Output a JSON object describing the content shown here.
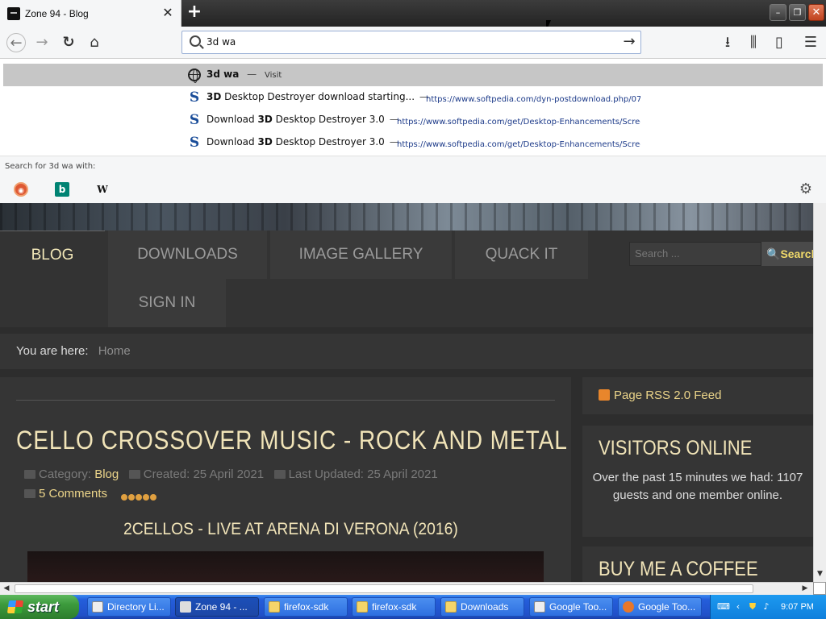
{
  "browser": {
    "tab": {
      "title": "Zone 94 - Blog"
    },
    "window_controls": {
      "minimize": "–",
      "maximize": "❐",
      "close": "✕"
    },
    "url_input": {
      "value": "3d wa"
    }
  },
  "dropdown": {
    "rows": [
      {
        "bold": "3d wa",
        "sep": "—",
        "suffix": "Visit",
        "url": ""
      },
      {
        "bold": "3D",
        "title": " Desktop Destroyer download starting...",
        "sep": "—",
        "url": "https://www.softpedia.com/dyn-postdownload.php/07"
      },
      {
        "bold": "3D",
        "prefix": "Download ",
        "title": " Desktop Destroyer 3.0",
        "sep": "—",
        "url": "https://www.softpedia.com/get/Desktop-Enhancements/Scree"
      },
      {
        "bold": "3D",
        "prefix": "Download ",
        "title": " Desktop Destroyer 3.0",
        "sep": "—",
        "url": "https://www.softpedia.com/get/Desktop-Enhancements/Scree"
      }
    ],
    "search_with": "Search for 3d wa with:",
    "engines": {
      "ddg": "ddg",
      "bing": "b",
      "wiki": "W"
    }
  },
  "site": {
    "menu": {
      "blog": "BLOG",
      "downloads": "DOWNLOADS",
      "gallery": "IMAGE GALLERY",
      "quack": "QUACK IT",
      "signin": "SIGN IN"
    },
    "search": {
      "placeholder": "Search ...",
      "button": "Search"
    },
    "breadcrumb": {
      "label": "You are here:",
      "home": "Home"
    },
    "article": {
      "title": "CELLO CROSSOVER MUSIC - ROCK AND METAL",
      "category_label": "Category:",
      "category": "Blog",
      "created": "Created: 25 April 2021",
      "updated": "Last Updated: 25 April 2021",
      "comments": "5 Comments",
      "rating": 5,
      "video_title": "2CELLOS - LIVE AT ARENA DI VERONA (2016)"
    },
    "sidebar": {
      "rss": "Page RSS 2.0 Feed",
      "visitors_title": "VISITORS ONLINE",
      "visitors_text": "Over the past 15 minutes we had: 1107 guests and one member online.",
      "coffee_title": "BUY ME A COFFEE"
    }
  },
  "taskbar": {
    "start": "start",
    "tasks": [
      "Directory Li...",
      "Zone 94 - ...",
      "firefox-sdk",
      "firefox-sdk",
      "Downloads",
      "Google Too...",
      "Google Too..."
    ],
    "clock": "9:07 PM"
  },
  "colors": {
    "accent_gold": "#f1e4b8",
    "link_gold": "#ecd58a",
    "page_bg": "#2d2d2d",
    "dropdown_selected": "#c6c6c6"
  }
}
